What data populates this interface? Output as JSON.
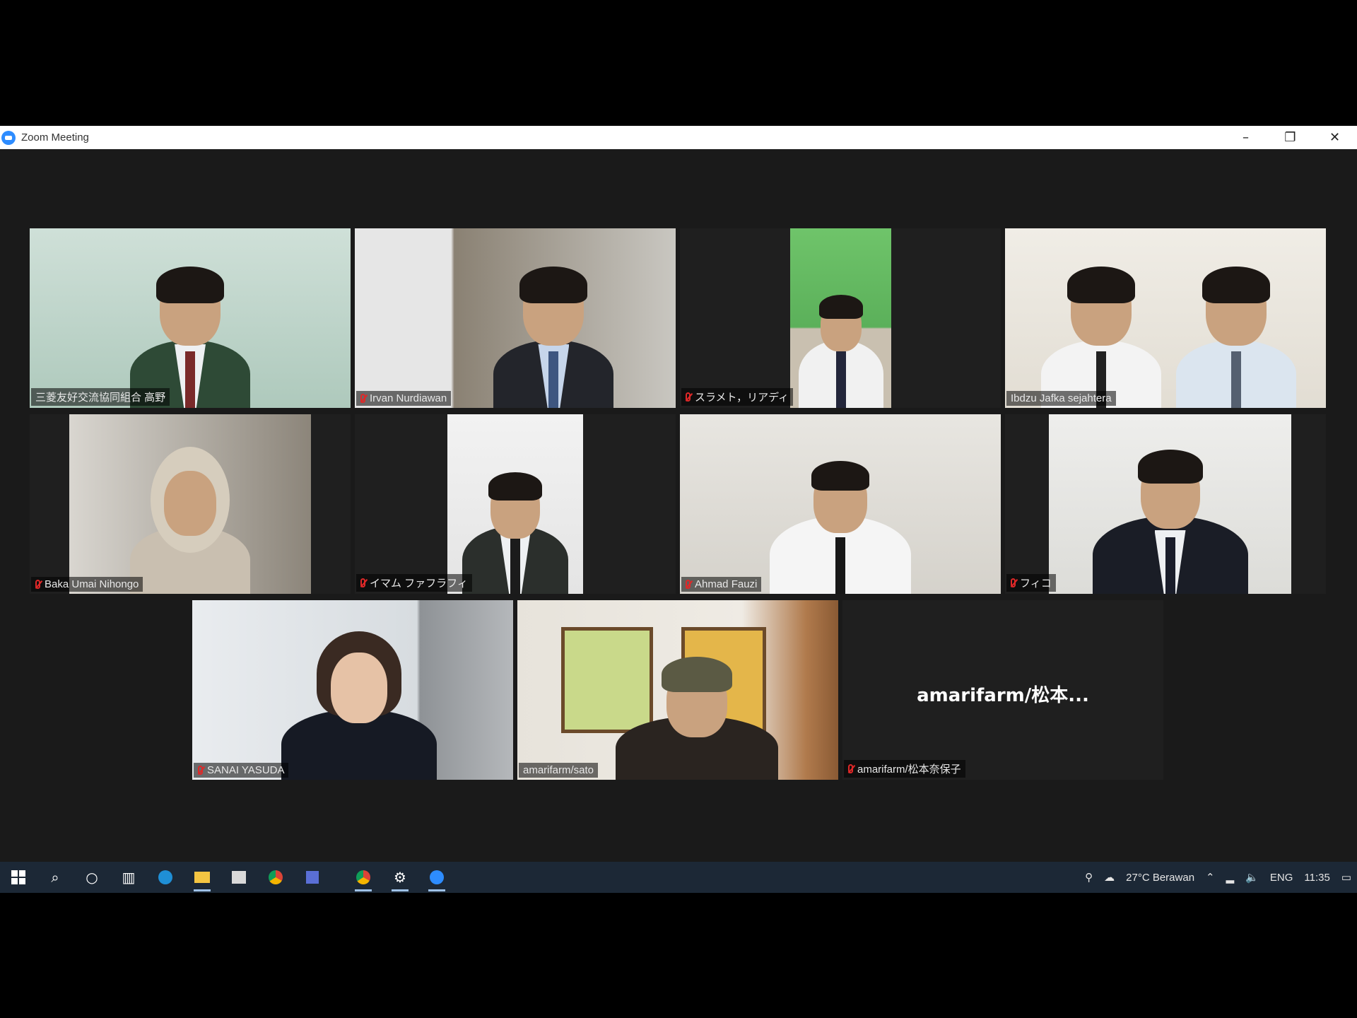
{
  "window": {
    "title": "Zoom Meeting",
    "minimize": "–",
    "restore": "❐",
    "close": "✕"
  },
  "participants": [
    {
      "name": "三菱友好交流協同組合 高野"
    },
    {
      "name": "Irvan Nurdiawan"
    },
    {
      "name": "スラメト，リアディ"
    },
    {
      "name": "Ibdzu Jafka sejahtera"
    },
    {
      "name": "Baka Umai Nihongo"
    },
    {
      "name": "イマム ファフラフィ"
    },
    {
      "name": "Ahmad Fauzi"
    },
    {
      "name": "フィコ"
    },
    {
      "name": "SANAI YASUDA"
    },
    {
      "name": "amarifarm/sato"
    },
    {
      "name": "amarifarm/松本奈保子",
      "display_name": "amarifarm/松本..."
    }
  ],
  "taskbar": {
    "weather": "27°C  Berawan",
    "language": "ENG",
    "time": "11:35",
    "icons": [
      "windows-icon",
      "search-icon",
      "cortana-icon",
      "task-view-icon",
      "edge-icon",
      "file-explorer-icon",
      "store-icon",
      "chrome-icon",
      "app-icon",
      "chrome-icon",
      "settings-icon",
      "zoom-icon"
    ]
  }
}
